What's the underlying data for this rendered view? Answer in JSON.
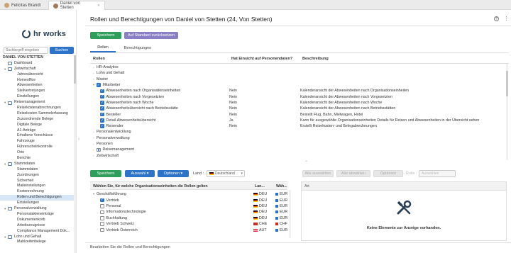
{
  "tabs": [
    {
      "label": "Felicitas Brandt"
    },
    {
      "label": "Daniel von Stetten"
    }
  ],
  "sidebar": {
    "logo": "hr works",
    "search_placeholder": "Suchbegriff eingeben",
    "search_button": "Suchen",
    "user": "DANIEL VON STETTEN",
    "items": [
      {
        "label": "Dashboard",
        "level": 1,
        "toggle": ""
      },
      {
        "label": "Zeitwirtschaft",
        "level": 1,
        "toggle": "▾"
      },
      {
        "label": "Jahresübersicht",
        "level": 2
      },
      {
        "label": "Homeoffice",
        "level": 2
      },
      {
        "label": "Abwesenheiten",
        "level": 2
      },
      {
        "label": "Stellvertretungen",
        "level": 2
      },
      {
        "label": "Einstellungen",
        "level": 2
      },
      {
        "label": "Reisemanagement",
        "level": 1,
        "toggle": "▾"
      },
      {
        "label": "Reisekostenabrechnungen",
        "level": 2
      },
      {
        "label": "Reisekosten Sammelerfassung",
        "level": 2
      },
      {
        "label": "Zuzuordnende Belege",
        "level": 2
      },
      {
        "label": "Digitale Belege",
        "level": 2
      },
      {
        "label": "A1-Anträge",
        "level": 2
      },
      {
        "label": "Erhaltene Vorschüsse",
        "level": 2
      },
      {
        "label": "Fahrzeuge",
        "level": 2
      },
      {
        "label": "Führerscheinkontrolle",
        "level": 2
      },
      {
        "label": "Orte",
        "level": 2
      },
      {
        "label": "Berichte",
        "level": 2
      },
      {
        "label": "Stammdaten",
        "level": 1,
        "toggle": "▾"
      },
      {
        "label": "Stammdaten",
        "level": 2
      },
      {
        "label": "Zuordnungen",
        "level": 2
      },
      {
        "label": "Sicherheit",
        "level": 2
      },
      {
        "label": "Maileinstellungen",
        "level": 2
      },
      {
        "label": "Kostenrechnung",
        "level": 2
      },
      {
        "label": "Rollen und Berechtigungen",
        "level": 2,
        "active": true
      },
      {
        "label": "Einstellungen",
        "level": 2
      },
      {
        "label": "Personalverwaltung",
        "level": 1,
        "toggle": "▾"
      },
      {
        "label": "Personalakteneinträge",
        "level": 2
      },
      {
        "label": "Dokumentenkorb",
        "level": 2
      },
      {
        "label": "Arbeitszeugnisse",
        "level": 2
      },
      {
        "label": "Compliance Management Dok...",
        "level": 2
      },
      {
        "label": "Lohn und Gehalt",
        "level": 1,
        "toggle": "▾"
      },
      {
        "label": "Mahlzeitenbelege",
        "level": 2
      }
    ]
  },
  "main": {
    "title": "Rollen und Berechtigungen von Daniel von Stetten (24, Von Stetten)",
    "save_label": "Speichern",
    "reset_label": "Auf Standard zurücksetzen",
    "tabs": [
      {
        "label": "Rollen"
      },
      {
        "label": "Berechtigungen"
      }
    ],
    "columns": {
      "rollen": "Rollen",
      "einsicht": "Hat Einsicht auf Personendaten?",
      "beschreibung": "Beschreibung"
    },
    "roles": [
      {
        "name": "HR-Analytics",
        "toggle": "›",
        "check": "none",
        "indent": 0,
        "ein": "",
        "desc": ""
      },
      {
        "name": "Lohn und Gehalt",
        "toggle": "›",
        "check": "none",
        "indent": 0,
        "ein": "",
        "desc": ""
      },
      {
        "name": "Master",
        "toggle": "›",
        "check": "none",
        "indent": 0,
        "ein": "",
        "desc": ""
      },
      {
        "name": "Mitarbeiter",
        "toggle": "▾",
        "check": "on",
        "indent": 0,
        "ein": "",
        "desc": ""
      },
      {
        "name": "Abwesenheiten nach Organisationseinheiten",
        "toggle": "",
        "check": "on",
        "indent": 1,
        "ein": "Nein",
        "desc": "Kalenderansicht der Abwesenheiten nach Organisationseinheiten"
      },
      {
        "name": "Abwesenheiten nach Vorgesetzten",
        "toggle": "",
        "check": "on",
        "indent": 1,
        "ein": "Nein",
        "desc": "Kalenderansicht der Abwesenheiten nach Vorgesetzten"
      },
      {
        "name": "Abwesenheiten nach Woche",
        "toggle": "",
        "check": "on",
        "indent": 1,
        "ein": "Nein",
        "desc": "Kalenderansicht der Abwesenheiten nach Woche"
      },
      {
        "name": "Abwesenheitsübersicht nach Betriebsstätte",
        "toggle": "",
        "check": "on",
        "indent": 1,
        "ein": "Nein",
        "desc": "Kalenderansicht der Abwesenheiten nach Betriebsstätten"
      },
      {
        "name": "Besteller",
        "toggle": "",
        "check": "on",
        "indent": 1,
        "ein": "Nein",
        "desc": "Bestellt Flug, Bahn, Mietwagen, Hotel"
      },
      {
        "name": "Detail-Abwesenheitsübersicht",
        "toggle": "",
        "check": "on",
        "indent": 1,
        "ein": "Ja",
        "desc": "Kann für ausgewählte Organisationseinheiten Details für Reisen und Abwesenheiten in der Übersicht sehen"
      },
      {
        "name": "Reisender",
        "toggle": "",
        "check": "on",
        "indent": 1,
        "ein": "Nein",
        "desc": "Erstellt Reisekosten- und Belegabrechnungen"
      },
      {
        "name": "Personalentwicklung",
        "toggle": "›",
        "check": "none",
        "indent": 0,
        "ein": "",
        "desc": ""
      },
      {
        "name": "Personalverwaltung",
        "toggle": "›",
        "check": "none",
        "indent": 0,
        "ein": "",
        "desc": ""
      },
      {
        "name": "Personen",
        "toggle": "›",
        "check": "none",
        "indent": 0,
        "ein": "",
        "desc": ""
      },
      {
        "name": "Reisemanagement",
        "toggle": "›",
        "check": "dot",
        "indent": 0,
        "ein": "",
        "desc": ""
      },
      {
        "name": "Zeitwirtschaft",
        "toggle": "›",
        "check": "none",
        "indent": 0,
        "ein": "",
        "desc": ""
      }
    ]
  },
  "lower": {
    "save_label": "Speichern",
    "auswahl_label": "Auswahl",
    "optionen_label": "Optionen",
    "land_label": "Land :",
    "land_value": "Deutschland",
    "right_buttons": [
      "Alle auswählen",
      "Alle abwählen",
      "Optionen"
    ],
    "rolle_label": "Rolle :",
    "rolle_value": "Auswählen",
    "list_header": "Wählen Sie, für welche Organisationseinheiten die Rollen gelten",
    "col_land": "Lan...",
    "col_waeh": "Wäh...",
    "units": [
      {
        "name": "Geschäftsführung",
        "toggle": "▾",
        "check": "none",
        "indent": 0,
        "land": "DEU",
        "flag": "de",
        "cur": "EUR"
      },
      {
        "name": "Vertrieb",
        "toggle": "",
        "check": "on",
        "indent": 1,
        "land": "DEU",
        "flag": "de",
        "cur": "EUR"
      },
      {
        "name": "Personal",
        "toggle": "",
        "check": "off",
        "indent": 1,
        "land": "DEU",
        "flag": "de",
        "cur": "EUR"
      },
      {
        "name": "Informationstechnologie",
        "toggle": "",
        "check": "off",
        "indent": 1,
        "land": "DEU",
        "flag": "de",
        "cur": "EUR"
      },
      {
        "name": "Buchhaltung",
        "toggle": "",
        "check": "off",
        "indent": 1,
        "land": "DEU",
        "flag": "de",
        "cur": "EUR"
      },
      {
        "name": "Vertrieb Schweiz",
        "toggle": "",
        "check": "off",
        "indent": 1,
        "land": "CHE",
        "flag": "ch",
        "cur": "CHF"
      },
      {
        "name": "Vertrieb Österreich",
        "toggle": "",
        "check": "off",
        "indent": 1,
        "land": "AUT",
        "flag": "at",
        "cur": "EUR"
      }
    ],
    "right_header": "Art",
    "empty_text": "Keine Elemente zur Anzeige vorhanden."
  },
  "footer": "Bearbeiten Sie die Rollen und Berechtigungen"
}
